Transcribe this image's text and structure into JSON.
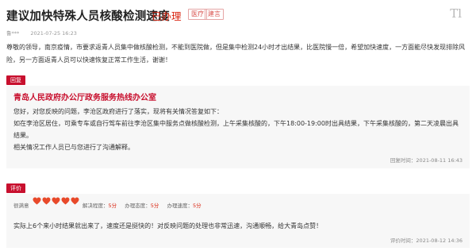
{
  "header": {
    "title": "建议加快特殊人员核酸检测速度",
    "status": "已办理",
    "tags": [
      "医疗",
      "建言"
    ],
    "logo": "Tl"
  },
  "meta": {
    "author": "鲁***",
    "time": "2021-07-25 16:23"
  },
  "question": {
    "text": "尊敬的领导，南京疫情，市要求返青人员集中做核酸检测，不能到医院做，但是集中检测24小时才出结果，比医院慢一倍，希望加快速度，一方面能尽快发现排除风险，另一方面返青人员可以快速恢复正常工作生活，谢谢！"
  },
  "reply": {
    "label": "回复",
    "org": "青岛人民政府办公厅政务服务热线办公室",
    "lines": [
      "您好，对您反映的问题，李沧区政府进行了落实，现将有关情况答复如下：",
      "如在李沧区居住，可乘专车或自行驾车前往李沧区集中服务点做核酸检测，上午采集核酸的，下午18:00-19:00时出具结果，下午采集核酸的，第二天凌晨出具结果。",
      "相关情况工作人员已与您进行了沟通解释。"
    ],
    "time": "回复时间：2021-08-11 16:43"
  },
  "evaluation": {
    "label": "评价",
    "satisfaction_label": "很满意",
    "hearts": 5,
    "heart_color": "#e8492a",
    "scores": [
      {
        "label": "解决程度：",
        "value": "5分"
      },
      {
        "label": "办理态度：",
        "value": "5分"
      },
      {
        "label": "办理速度：",
        "value": "5分"
      }
    ],
    "text": "实际上6个来小时结果就出来了，速度还是挺快的！对反映问题的处理也非常迅速，沟通顺畅，给大青岛点赞！",
    "time": "评价时间：2021-08-12 14:36"
  }
}
